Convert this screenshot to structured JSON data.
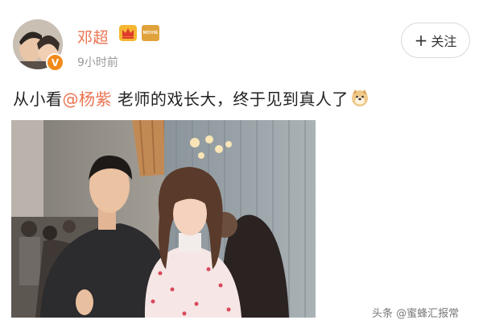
{
  "post": {
    "author": "邓超",
    "timestamp": "9小时前",
    "badge_text": "MOVIE",
    "verified_mark": "V",
    "follow": {
      "plus": "+",
      "label": "关注"
    },
    "text": {
      "prefix": "从小看",
      "mention": "@杨紫",
      "suffix": " 老师的戏长大，终于见到真人了"
    },
    "emoji_icon": "doge-face-icon"
  },
  "watermark": "头条 @蜜蜂汇报常",
  "colors": {
    "username": "#eb7350",
    "mention": "#eb7350",
    "timestamp": "#999999",
    "text": "#222222",
    "badge": "#e0a33c",
    "verified": "#f28a1a"
  }
}
